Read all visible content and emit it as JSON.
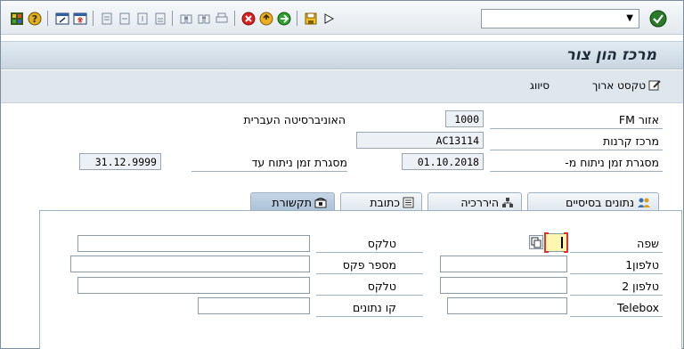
{
  "toolbar": {
    "icons": [
      "layout-icon",
      "help-icon",
      "create-session-icon",
      "generate-shortcut-icon",
      "first-page-icon",
      "previous-page-icon",
      "next-page-icon",
      "last-page-icon",
      "find-icon",
      "find-next-icon",
      "print-icon",
      "cancel-icon",
      "exit-icon",
      "back-icon",
      "save-icon",
      "execute-icon",
      "enter-icon"
    ],
    "command_value": ""
  },
  "title": "מרכז הון צור",
  "app_toolbar": {
    "long_text": "טקסט ארוך",
    "classification": "סיווג"
  },
  "header": {
    "fm_area_label": "אזור FM",
    "fm_area_value": "1000",
    "fm_area_text": "האוניברסיטה העברית",
    "fund_center_label": "מרכז קרנות",
    "fund_center_value": "AC13114",
    "validity_from_label": "מסגרת זמן ניתוח מ-",
    "validity_from_value": "01.10.2018",
    "validity_to_label": "מסגרת זמן ניתוח עד",
    "validity_to_value": "31.12.9999"
  },
  "tabs": [
    {
      "label": "נתונים בסיסיים",
      "active": false
    },
    {
      "label": "היררכיה",
      "active": false
    },
    {
      "label": "כתובת",
      "active": false
    },
    {
      "label": "תקשורת",
      "active": true
    }
  ],
  "communication": {
    "language_label": "שפה",
    "telex1_label": "טלקס",
    "telephone1_label": "טלפון1",
    "fax_label": "מספר פקס",
    "telephone2_label": "טלפון 2",
    "telex2_label": "טלקס",
    "telebox_label": "Telebox",
    "data_line_label": "קו נתונים"
  },
  "colors": {
    "title_bar": "#c9d6e1",
    "active_tab": "#aac1d6",
    "language_field": "#fff7b0",
    "focus_marker": "#e03030"
  }
}
